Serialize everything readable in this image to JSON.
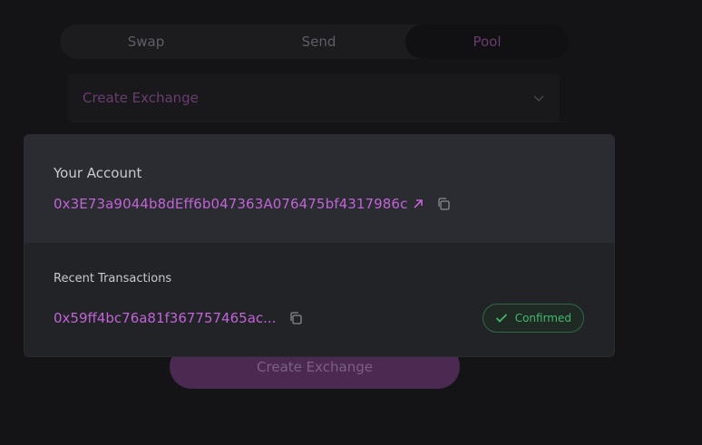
{
  "tabs": [
    {
      "label": "Swap"
    },
    {
      "label": "Send"
    },
    {
      "label": "Pool"
    }
  ],
  "pool": {
    "select_value": "Create Exchange",
    "submit_label": "Create Exchange"
  },
  "modal": {
    "account_title": "Your Account",
    "account_address": "0x3E73a9044b8dEff6b047363A076475bf4317986c",
    "recent_title": "Recent Transactions",
    "transactions": [
      {
        "hash": "0x59ff4bc76a81f367757465ac...",
        "status": "Confirmed"
      }
    ]
  },
  "colors": {
    "accent": "#c064d6",
    "confirmed": "#43b86c"
  },
  "icons": {
    "external_link": "external-link-icon",
    "copy": "copy-icon",
    "check": "check-icon",
    "chevron": "chevron-down-icon"
  }
}
